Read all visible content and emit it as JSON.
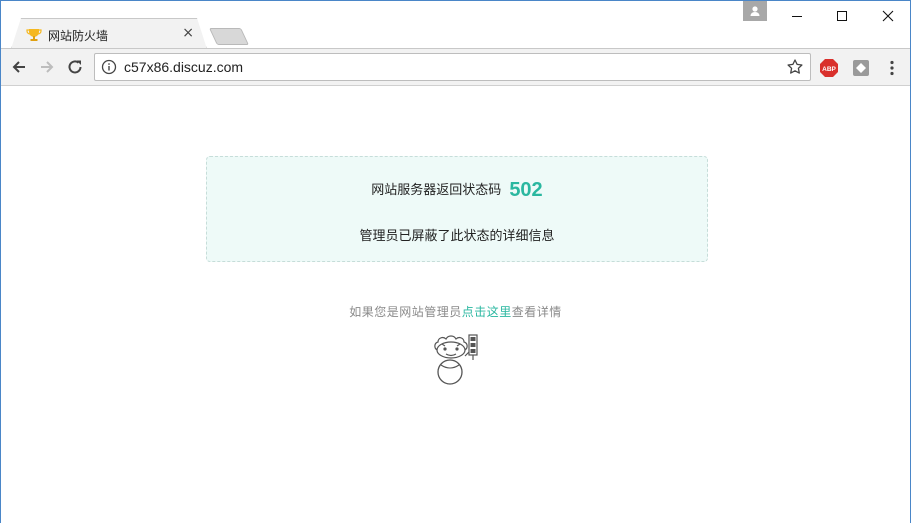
{
  "browser": {
    "tab": {
      "title": "网站防火墙",
      "close_glyph": "×",
      "favicon": "trophy-icon"
    },
    "address_bar": {
      "url": "c57x86.discuz.com"
    },
    "extensions": {
      "abp_label": "ABP"
    }
  },
  "notice": {
    "status_prefix": "网站服务器返回状态码",
    "status_code": "502",
    "blocked_message": "管理员已屏蔽了此状态的详细信息"
  },
  "admin_hint": {
    "before": "如果您是网站管理员",
    "link": "点击这里",
    "after": "查看详情"
  },
  "colors": {
    "accent": "#2ab7a0",
    "notice_bg": "#eefaf8"
  }
}
